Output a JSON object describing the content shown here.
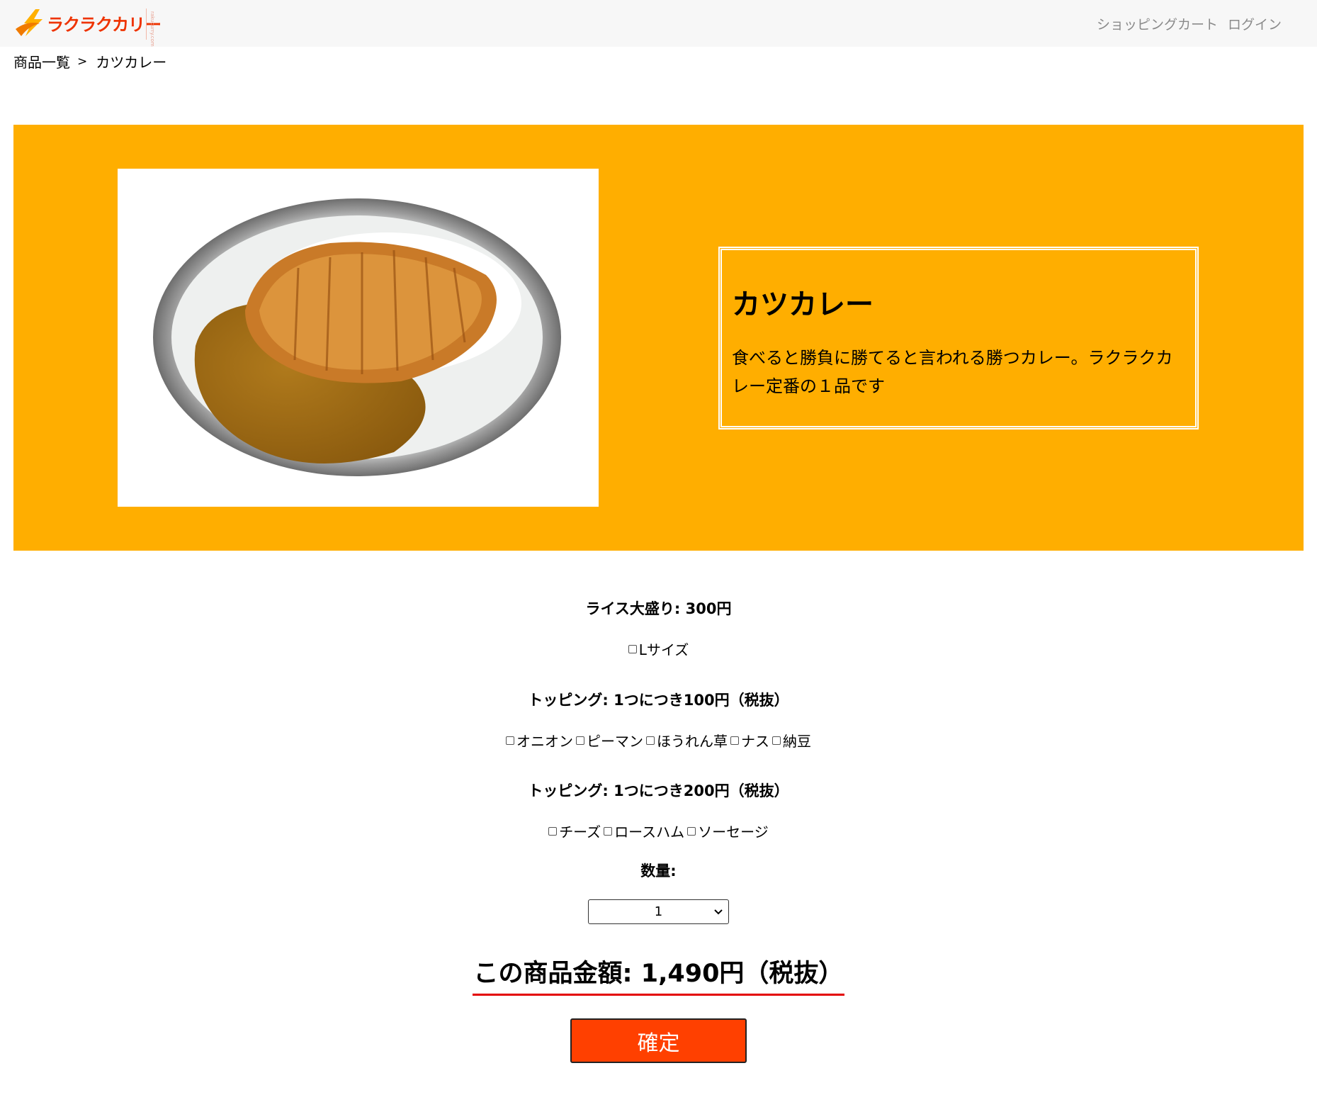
{
  "header": {
    "logo_text": "ラクラクカリー",
    "logo_sub": "rakucurry.com",
    "nav": {
      "cart": "ショッピングカート",
      "login": "ログイン"
    }
  },
  "breadcrumb": {
    "home": "商品一覧",
    "separator": ">",
    "current": "カツカレー"
  },
  "product": {
    "title": "カツカレー",
    "description": "食べると勝負に勝てると言われる勝つカレー。ラクラクカレー定番の１品です"
  },
  "options": {
    "rice": {
      "heading": "ライス大盛り: 300円",
      "items": [
        "Lサイズ"
      ]
    },
    "topping100": {
      "heading": "トッピング: 1つにつき100円（税抜）",
      "items": [
        "オニオン",
        "ピーマン",
        "ほうれん草",
        "ナス",
        "納豆"
      ]
    },
    "topping200": {
      "heading": "トッピング: 1つにつき200円（税抜）",
      "items": [
        "チーズ",
        "ロースハム",
        "ソーセージ"
      ]
    },
    "quantity": {
      "heading": "数量:",
      "selected": "1"
    }
  },
  "price": "この商品金額: 1,490円（税抜）",
  "confirm_label": "確定",
  "colors": {
    "hero_bg": "#ffae00",
    "confirm_bg": "#ff4000",
    "price_underline": "#e30000",
    "logo": "#ee3300"
  }
}
